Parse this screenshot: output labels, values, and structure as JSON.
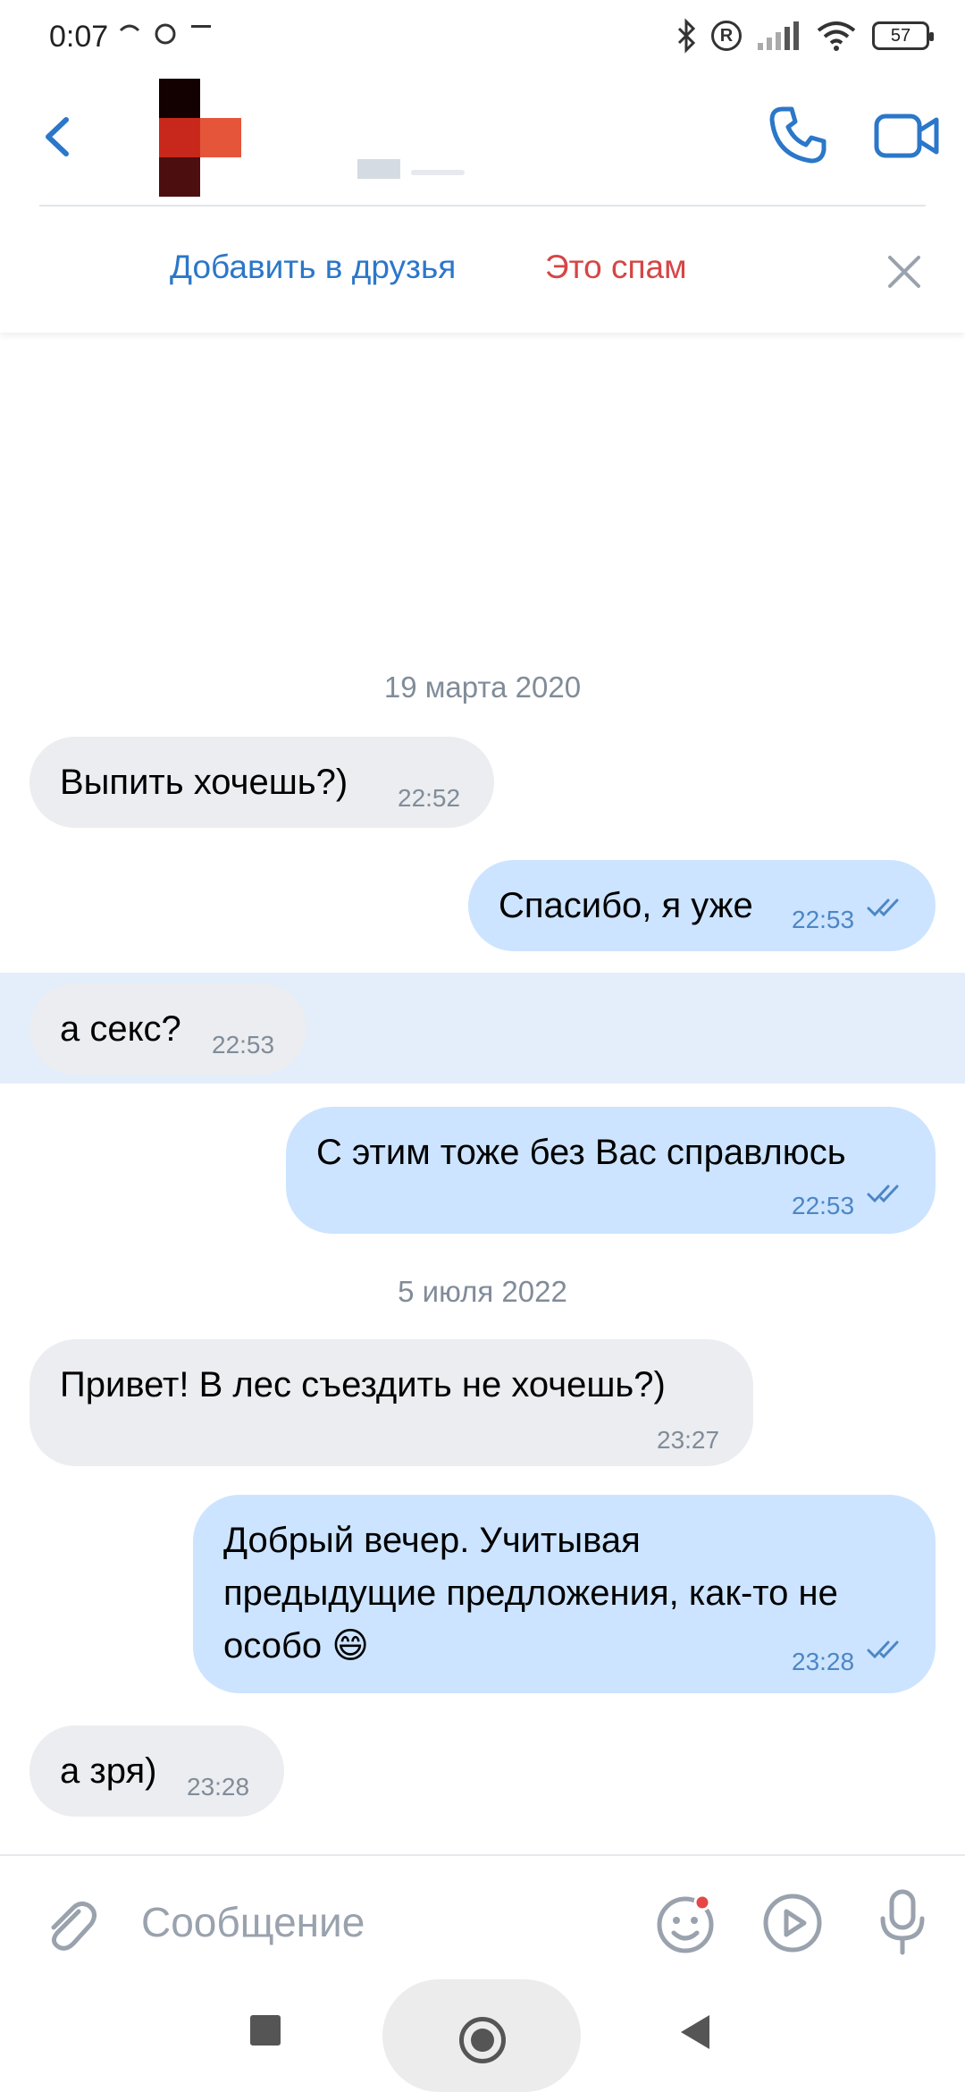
{
  "status_bar": {
    "time": "0:07",
    "battery": "57",
    "icons": [
      "sync-icon",
      "alarm-icon",
      "notification-icon",
      "bluetooth-icon",
      "roaming-icon",
      "signal-icon",
      "wifi-icon",
      "battery-icon"
    ],
    "roaming_label": "R"
  },
  "header": {
    "back_icon": "chevron-left-icon",
    "call_icon": "phone-icon",
    "video_icon": "video-camera-icon",
    "accent_color": "#2b77c9"
  },
  "friend_banner": {
    "add_friend": "Добавить в друзья",
    "spam": "Это спам",
    "close_icon": "close-icon"
  },
  "messages": [
    {
      "type": "date",
      "text": "19 марта 2020"
    },
    {
      "type": "in",
      "text": "Выпить хочешь?)",
      "time": "22:52"
    },
    {
      "type": "out",
      "text": "Спасибо, я уже",
      "time": "22:53",
      "read": true
    },
    {
      "type": "in",
      "text": "а секс?",
      "time": "22:53",
      "highlighted": true
    },
    {
      "type": "out",
      "text": "С этим тоже без Вас справлюсь",
      "time": "22:53",
      "read": true
    },
    {
      "type": "date",
      "text": "5 июля 2022"
    },
    {
      "type": "in",
      "text": "Привет! В лес съездить не хочешь?)",
      "time": "23:27"
    },
    {
      "type": "out",
      "lines": [
        "Добрый вечер. Учитывая",
        "предыдущие предложения, как-то не",
        "особо 😄"
      ],
      "time": "23:28",
      "read": true
    },
    {
      "type": "in",
      "text": "а зря)",
      "time": "23:28"
    }
  ],
  "composer": {
    "placeholder": "Сообщение",
    "icons": [
      "paperclip-icon",
      "sticker-icon",
      "play-icon",
      "microphone-icon"
    ]
  },
  "nav": {
    "icons": [
      "recent-apps-icon",
      "home-icon",
      "back-icon"
    ]
  },
  "colors": {
    "incoming_bubble": "#ebedf0",
    "outgoing_bubble": "#cce4ff",
    "highlight_row": "#e3eefa",
    "spam_red": "#d64545",
    "time_gray": "#818c99",
    "time_blue": "#4d86c5"
  }
}
